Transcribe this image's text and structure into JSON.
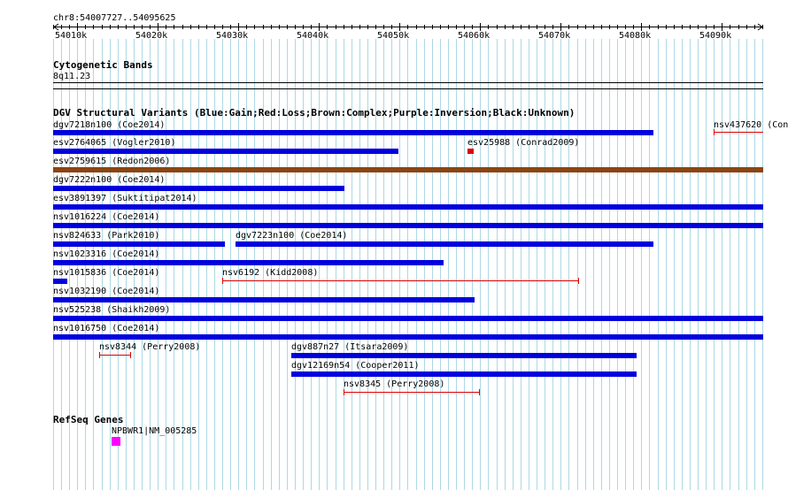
{
  "location": "chr8:54007727..54095625",
  "ruler": {
    "ticks": [
      "54010k",
      "54020k",
      "54030k",
      "54040k",
      "54050k",
      "54060k",
      "54070k",
      "54080k",
      "54090k"
    ]
  },
  "tracks": {
    "cytoband": {
      "title": "Cytogenetic Bands",
      "band": "8q11.23"
    },
    "dgv": {
      "title": "DGV Structural Variants (Blue:Gain;Red:Loss;Brown:Complex;Purple:Inversion;Black:Unknown)",
      "colors": {
        "gain": "#0000dd",
        "loss": "#dd0000",
        "complex": "#8b4513"
      },
      "features": [
        {
          "label": "dgv7218n100 (Coe2014)",
          "type": "gain",
          "style": "bar"
        },
        {
          "label": "nsv437620 (Con",
          "type": "loss",
          "style": "line"
        },
        {
          "label": "esv2764065 (Vogler2010)",
          "type": "gain",
          "style": "bar"
        },
        {
          "label": "esv25988 (Conrad2009)",
          "type": "loss",
          "style": "bar"
        },
        {
          "label": "esv2759615 (Redon2006)",
          "type": "complex",
          "style": "bar"
        },
        {
          "label": "dgv7222n100 (Coe2014)",
          "type": "gain",
          "style": "bar"
        },
        {
          "label": "esv3891397 (Suktitipat2014)",
          "type": "gain",
          "style": "bar"
        },
        {
          "label": "nsv1016224 (Coe2014)",
          "type": "gain",
          "style": "bar"
        },
        {
          "label": "nsv824633 (Park2010)",
          "type": "gain",
          "style": "bar"
        },
        {
          "label": "dgv7223n100 (Coe2014)",
          "type": "gain",
          "style": "bar"
        },
        {
          "label": "nsv1023316 (Coe2014)",
          "type": "gain",
          "style": "bar"
        },
        {
          "label": "nsv1015836 (Coe2014)",
          "type": "gain",
          "style": "bar"
        },
        {
          "label": "nsv6192 (Kidd2008)",
          "type": "loss",
          "style": "line"
        },
        {
          "label": "nsv1032190 (Coe2014)",
          "type": "gain",
          "style": "bar"
        },
        {
          "label": "nsv525238 (Shaikh2009)",
          "type": "gain",
          "style": "bar"
        },
        {
          "label": "nsv1016750 (Coe2014)",
          "type": "gain",
          "style": "bar"
        },
        {
          "label": "nsv8344 (Perry2008)",
          "type": "loss",
          "style": "line"
        },
        {
          "label": "dgv887n27 (Itsara2009)",
          "type": "gain",
          "style": "bar"
        },
        {
          "label": "dgv12169n54 (Cooper2011)",
          "type": "gain",
          "style": "bar"
        },
        {
          "label": "nsv8345 (Perry2008)",
          "type": "loss",
          "style": "line"
        }
      ]
    },
    "refseq": {
      "title": "RefSeq Genes",
      "genes": [
        {
          "label": "NPBWR1|NM_005285",
          "color": "#ff00ff"
        }
      ]
    }
  },
  "colors": {
    "grid": "#add8e6",
    "ruler": "#000000"
  }
}
